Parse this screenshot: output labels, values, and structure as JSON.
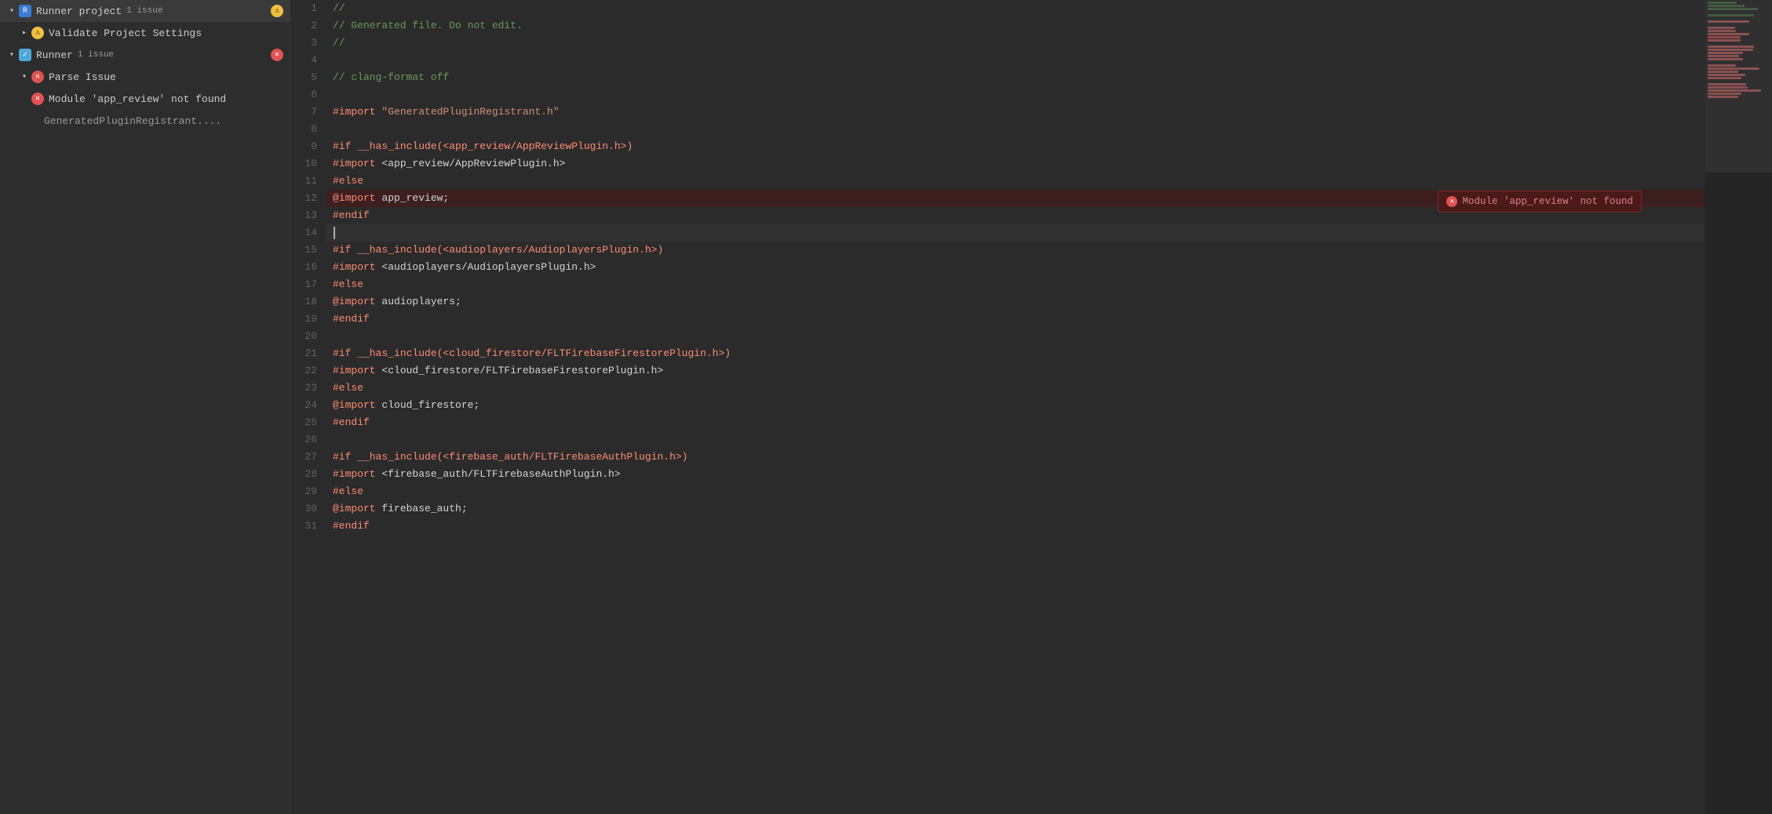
{
  "sidebar": {
    "items": [
      {
        "id": "runner-project",
        "label": "Runner project",
        "badge": "1 issue",
        "indent": 0,
        "chevron": "down",
        "icon": "warning-triangle",
        "has_warning": true
      },
      {
        "id": "validate-project-settings",
        "label": "Validate Project Settings",
        "indent": 1,
        "chevron": "right",
        "icon": "warning"
      },
      {
        "id": "runner",
        "label": "Runner",
        "badge": "1 issue",
        "indent": 0,
        "chevron": "down",
        "icon": "check-blue",
        "has_error": true
      },
      {
        "id": "parse-issue",
        "label": "Parse Issue",
        "indent": 1,
        "chevron": "down",
        "icon": "error"
      },
      {
        "id": "module-not-found",
        "label": "Module 'app_review' not found",
        "indent": 2,
        "icon": "error"
      },
      {
        "id": "generated-file",
        "label": "GeneratedPluginRegistrant....",
        "indent": 3,
        "icon": "none"
      }
    ]
  },
  "editor": {
    "lines": [
      {
        "num": 1,
        "tokens": [
          {
            "text": "//",
            "class": "c-comment"
          }
        ]
      },
      {
        "num": 2,
        "tokens": [
          {
            "text": "// Generated file. Do not edit.",
            "class": "c-comment"
          }
        ]
      },
      {
        "num": 3,
        "tokens": [
          {
            "text": "//",
            "class": "c-comment"
          }
        ]
      },
      {
        "num": 4,
        "tokens": []
      },
      {
        "num": 5,
        "tokens": [
          {
            "text": "// clang-format off",
            "class": "c-comment"
          }
        ]
      },
      {
        "num": 6,
        "tokens": []
      },
      {
        "num": 7,
        "tokens": [
          {
            "text": "#import",
            "class": "c-hash"
          },
          {
            "text": " ",
            "class": "c-plain"
          },
          {
            "text": "\"GeneratedPluginRegistrant.h\"",
            "class": "c-string"
          }
        ]
      },
      {
        "num": 8,
        "tokens": []
      },
      {
        "num": 9,
        "tokens": [
          {
            "text": "#if __has_include(<app_review/AppReviewPlugin.h>)",
            "class": "c-hash"
          }
        ]
      },
      {
        "num": 10,
        "tokens": [
          {
            "text": "#import",
            "class": "c-hash"
          },
          {
            "text": " <app_review/AppReviewPlugin.h>",
            "class": "c-plain"
          }
        ]
      },
      {
        "num": 11,
        "tokens": [
          {
            "text": "#else",
            "class": "c-hash"
          }
        ]
      },
      {
        "num": 12,
        "tokens": [
          {
            "text": "@import",
            "class": "c-import-kw"
          },
          {
            "text": " app_review;",
            "class": "c-plain"
          }
        ],
        "error": true,
        "error_msg": "Module 'app_review' not found"
      },
      {
        "num": 13,
        "tokens": [
          {
            "text": "#endif",
            "class": "c-hash"
          }
        ]
      },
      {
        "num": 14,
        "tokens": [],
        "cursor": true
      },
      {
        "num": 15,
        "tokens": [
          {
            "text": "#if __has_include(<audioplayers/AudioplayersPlugin.h>)",
            "class": "c-hash"
          }
        ]
      },
      {
        "num": 16,
        "tokens": [
          {
            "text": "#import",
            "class": "c-hash"
          },
          {
            "text": " <audioplayers/AudioplayersPlugin.h>",
            "class": "c-plain"
          }
        ]
      },
      {
        "num": 17,
        "tokens": [
          {
            "text": "#else",
            "class": "c-hash"
          }
        ]
      },
      {
        "num": 18,
        "tokens": [
          {
            "text": "@import",
            "class": "c-import-kw"
          },
          {
            "text": " audioplayers;",
            "class": "c-plain"
          }
        ]
      },
      {
        "num": 19,
        "tokens": [
          {
            "text": "#endif",
            "class": "c-hash"
          }
        ]
      },
      {
        "num": 20,
        "tokens": []
      },
      {
        "num": 21,
        "tokens": [
          {
            "text": "#if __has_include(<cloud_firestore/FLTFirebaseFirestorePlugin.h>)",
            "class": "c-hash"
          }
        ]
      },
      {
        "num": 22,
        "tokens": [
          {
            "text": "#import",
            "class": "c-hash"
          },
          {
            "text": " <cloud_firestore/FLTFirebaseFirestorePlugin.h>",
            "class": "c-plain"
          }
        ]
      },
      {
        "num": 23,
        "tokens": [
          {
            "text": "#else",
            "class": "c-hash"
          }
        ]
      },
      {
        "num": 24,
        "tokens": [
          {
            "text": "@import",
            "class": "c-import-kw"
          },
          {
            "text": " cloud_firestore;",
            "class": "c-plain"
          }
        ]
      },
      {
        "num": 25,
        "tokens": [
          {
            "text": "#endif",
            "class": "c-hash"
          }
        ]
      },
      {
        "num": 26,
        "tokens": []
      },
      {
        "num": 27,
        "tokens": [
          {
            "text": "#if __has_include(<firebase_auth/FLTFirebaseAuthPlugin.h>)",
            "class": "c-hash"
          }
        ]
      },
      {
        "num": 28,
        "tokens": [
          {
            "text": "#import",
            "class": "c-hash"
          },
          {
            "text": " <firebase_auth/FLTFirebaseAuthPlugin.h>",
            "class": "c-plain"
          }
        ]
      },
      {
        "num": 29,
        "tokens": [
          {
            "text": "#else",
            "class": "c-hash"
          }
        ]
      },
      {
        "num": 30,
        "tokens": [
          {
            "text": "@import",
            "class": "c-import-kw"
          },
          {
            "text": " firebase_auth;",
            "class": "c-plain"
          }
        ]
      },
      {
        "num": 31,
        "tokens": [
          {
            "text": "#endif",
            "class": "c-hash"
          }
        ]
      }
    ],
    "error_tooltip": "Module 'app_review' not found"
  },
  "icons": {
    "warning_char": "⚠",
    "error_char": "✕",
    "check_char": "✓",
    "chevron_down": "▾",
    "chevron_right": "▸"
  },
  "colors": {
    "sidebar_bg": "#2d2d2d",
    "editor_bg": "#2b2b2b",
    "error_bg": "#3d1f1f",
    "warning_color": "#f0c040",
    "error_color": "#e05252",
    "blue_color": "#4fa8da"
  }
}
